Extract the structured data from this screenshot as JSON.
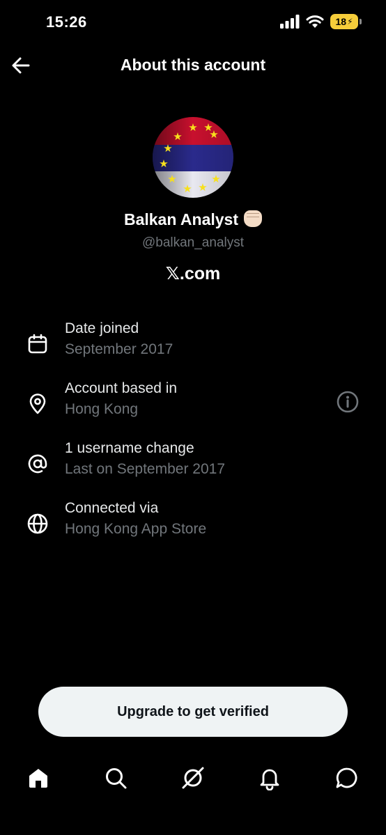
{
  "status_bar": {
    "time": "15:26",
    "battery": "18"
  },
  "header": {
    "title": "About this account"
  },
  "profile": {
    "display_name": "Balkan Analyst",
    "handle": "@balkan_analyst",
    "site": "𝕏.com"
  },
  "info": [
    {
      "icon": "calendar-icon",
      "label": "Date joined",
      "value": "September 2017"
    },
    {
      "icon": "location-pin-icon",
      "label": "Account based in",
      "value": "Hong Kong"
    },
    {
      "icon": "at-sign-icon",
      "label": "1 username change",
      "value": "Last on September 2017"
    },
    {
      "icon": "globe-icon",
      "label": "Connected via",
      "value": "Hong Kong App Store"
    }
  ],
  "upgrade_button": {
    "label": "Upgrade to get verified"
  },
  "tabs": [
    "home-icon",
    "search-icon",
    "grok-icon",
    "notifications-icon",
    "messages-icon"
  ],
  "colors": {
    "background": "#000000",
    "muted": "#71767b",
    "button": "#eff3f4",
    "battery": "#f6cd3a"
  }
}
